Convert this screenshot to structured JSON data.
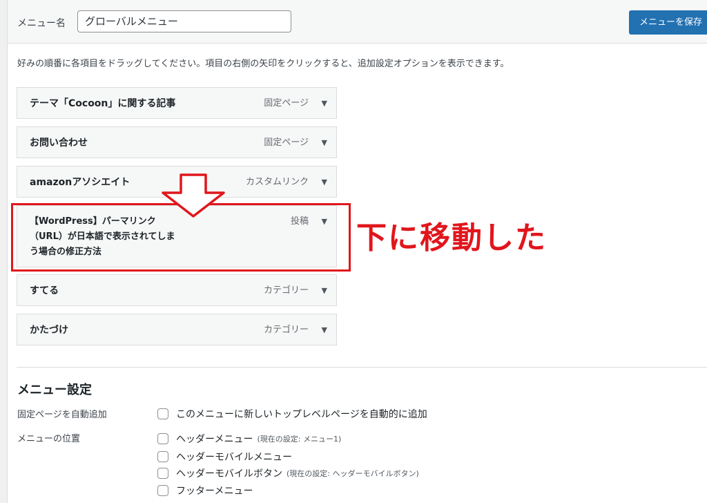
{
  "header": {
    "menu_name_label": "メニュー名",
    "menu_name_value": "グローバルメニュー",
    "save_label": "メニューを保存"
  },
  "instructions": "好みの順番に各項目をドラッグしてください。項目の右側の矢印をクリックすると、追加設定オプションを表示できます。",
  "menu_items": [
    {
      "title": "テーマ「Cocoon」に関する記事",
      "type": "固定ページ"
    },
    {
      "title": "お問い合わせ",
      "type": "固定ページ"
    },
    {
      "title": "amazonアソシエイト",
      "type": "カスタムリンク"
    },
    {
      "title_lines": [
        "【WordPress】パーマリンク",
        "（URL）が日本語で表示されてしま",
        "う場合の修正方法"
      ],
      "type": "投稿"
    },
    {
      "title": "すてる",
      "type": "カテゴリー"
    },
    {
      "title": "かたづけ",
      "type": "カテゴリー"
    }
  ],
  "annotation": {
    "moved_text": "下に移動した",
    "color": "#e0161c"
  },
  "settings": {
    "heading": "メニュー設定",
    "auto_add_label": "固定ページを自動追加",
    "auto_add_option": "このメニューに新しいトップレベルページを自動的に追加",
    "location_label": "メニューの位置",
    "locations": [
      {
        "label": "ヘッダーメニュー",
        "note": "(現在の設定: メニュー1)"
      },
      {
        "label": "ヘッダーモバイルメニュー",
        "note": ""
      },
      {
        "label": "ヘッダーモバイルボタン",
        "note": "(現在の設定: ヘッダーモバイルボタン)"
      },
      {
        "label": "フッターメニュー",
        "note": ""
      }
    ]
  },
  "colors": {
    "primary_button": "#2271b1",
    "annotation_red": "#e0161c"
  }
}
